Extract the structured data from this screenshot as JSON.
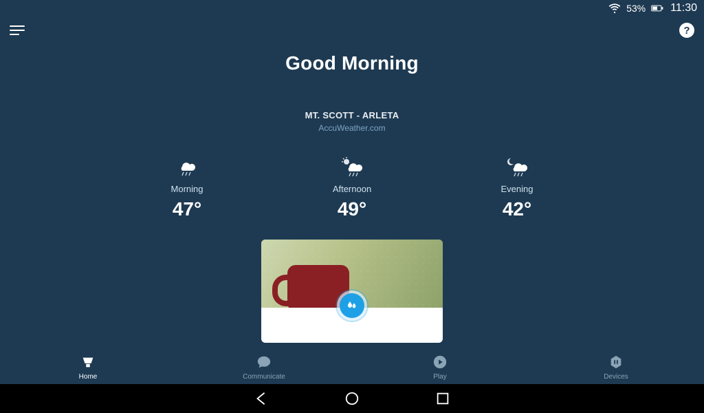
{
  "status": {
    "battery_pct": "53%",
    "time": "11:30"
  },
  "header": {
    "greeting": "Good Morning",
    "location": "MT. SCOTT - ARLETA",
    "source": "AccuWeather.com"
  },
  "forecast": [
    {
      "label": "Morning",
      "temp": "47°",
      "icon": "rain"
    },
    {
      "label": "Afternoon",
      "temp": "49°",
      "icon": "partly-rain"
    },
    {
      "label": "Evening",
      "temp": "42°",
      "icon": "night-rain"
    }
  ],
  "card": {
    "badge_icon": "raindrops"
  },
  "tabs": [
    {
      "label": "Home",
      "icon": "home",
      "active": true
    },
    {
      "label": "Communicate",
      "icon": "chat",
      "active": false
    },
    {
      "label": "Play",
      "icon": "play",
      "active": false
    },
    {
      "label": "Devices",
      "icon": "devices",
      "active": false
    }
  ],
  "help_glyph": "?"
}
